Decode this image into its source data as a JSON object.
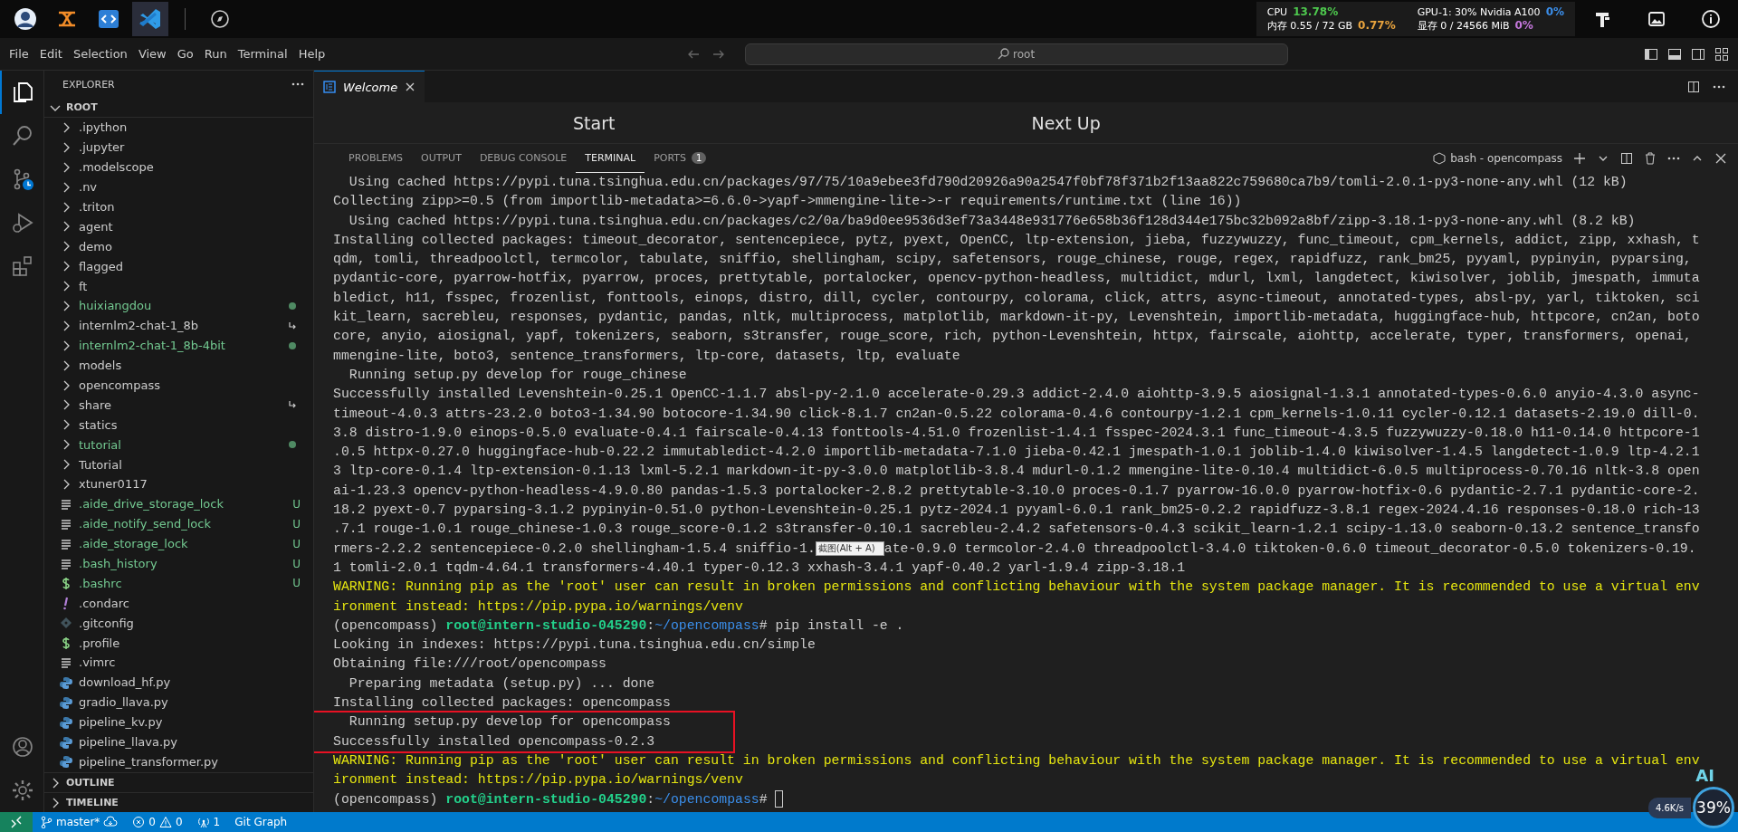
{
  "system_bar": {
    "apps": [
      {
        "selected": false
      },
      {
        "selected": false
      },
      {
        "selected": false
      },
      {
        "selected": true
      },
      {
        "selected": false
      }
    ],
    "stats": [
      {
        "label": "CPU",
        "value": "13.78%",
        "color": "#4ec94e"
      },
      {
        "label": "GPU-1: 30% Nvidia A100",
        "value": "0%",
        "color": "#3b8eea"
      },
      {
        "label": "内存 0.55 / 72 GB",
        "value": "0.77%",
        "color": "#e8a33d"
      },
      {
        "label": "显存 0 / 24566 MiB",
        "value": "0%",
        "color": "#c678dd"
      }
    ]
  },
  "title_bar": {
    "menu": [
      "File",
      "Edit",
      "Selection",
      "View",
      "Go",
      "Run",
      "Terminal",
      "Help"
    ],
    "search": "root"
  },
  "sidebar": {
    "title": "EXPLORER",
    "root": "ROOT",
    "items": [
      {
        "kind": "folder",
        "name": ".ipython",
        "color": "#cccccc"
      },
      {
        "kind": "folder",
        "name": ".jupyter",
        "color": "#cccccc"
      },
      {
        "kind": "folder",
        "name": ".modelscope",
        "color": "#cccccc"
      },
      {
        "kind": "folder",
        "name": ".nv",
        "color": "#cccccc"
      },
      {
        "kind": "folder",
        "name": ".triton",
        "color": "#cccccc"
      },
      {
        "kind": "folder",
        "name": "agent",
        "color": "#cccccc"
      },
      {
        "kind": "folder",
        "name": "demo",
        "color": "#cccccc"
      },
      {
        "kind": "folder",
        "name": "flagged",
        "color": "#cccccc"
      },
      {
        "kind": "folder",
        "name": "ft",
        "color": "#cccccc"
      },
      {
        "kind": "folder",
        "name": "huixiangdou",
        "color": "#73c991",
        "modified": true
      },
      {
        "kind": "folder",
        "name": "internlm2-chat-1_8b",
        "color": "#cccccc",
        "symlink": true
      },
      {
        "kind": "folder",
        "name": "internlm2-chat-1_8b-4bit",
        "color": "#73c991",
        "modified": true
      },
      {
        "kind": "folder",
        "name": "models",
        "color": "#cccccc"
      },
      {
        "kind": "folder",
        "name": "opencompass",
        "color": "#cccccc"
      },
      {
        "kind": "folder",
        "name": "share",
        "color": "#cccccc",
        "symlink": true
      },
      {
        "kind": "folder",
        "name": "statics",
        "color": "#cccccc"
      },
      {
        "kind": "folder",
        "name": "tutorial",
        "color": "#73c991",
        "modified": true
      },
      {
        "kind": "folder",
        "name": "Tutorial",
        "color": "#cccccc"
      },
      {
        "kind": "folder",
        "name": "xtuner0117",
        "color": "#cccccc"
      },
      {
        "kind": "text",
        "name": ".aide_drive_storage_lock",
        "color": "#73c991",
        "badge": "U"
      },
      {
        "kind": "text",
        "name": ".aide_notify_send_lock",
        "color": "#73c991",
        "badge": "U"
      },
      {
        "kind": "text",
        "name": ".aide_storage_lock",
        "color": "#73c991",
        "badge": "U"
      },
      {
        "kind": "text",
        "name": ".bash_history",
        "color": "#73c991",
        "badge": "U"
      },
      {
        "kind": "shell",
        "name": ".bashrc",
        "color": "#73c991",
        "badge": "U"
      },
      {
        "kind": "config",
        "name": ".condarc",
        "color": "#cccccc"
      },
      {
        "kind": "git",
        "name": ".gitconfig",
        "color": "#cccccc"
      },
      {
        "kind": "shell",
        "name": ".profile",
        "color": "#cccccc"
      },
      {
        "kind": "text",
        "name": ".vimrc",
        "color": "#cccccc"
      },
      {
        "kind": "python",
        "name": "download_hf.py",
        "color": "#cccccc"
      },
      {
        "kind": "python",
        "name": "gradio_llava.py",
        "color": "#cccccc"
      },
      {
        "kind": "python",
        "name": "pipeline_kv.py",
        "color": "#cccccc"
      },
      {
        "kind": "python",
        "name": "pipeline_llava.py",
        "color": "#cccccc"
      },
      {
        "kind": "python",
        "name": "pipeline_transformer.py",
        "color": "#cccccc"
      }
    ],
    "sections": [
      "OUTLINE",
      "TIMELINE"
    ]
  },
  "editor": {
    "tabs": [
      {
        "label": "Welcome",
        "selected": true
      }
    ],
    "headings": [
      "Start",
      "Next Up"
    ]
  },
  "panel": {
    "tabs": [
      {
        "label": "PROBLEMS",
        "selected": false
      },
      {
        "label": "OUTPUT",
        "selected": false
      },
      {
        "label": "DEBUG CONSOLE",
        "selected": false
      },
      {
        "label": "TERMINAL",
        "selected": true
      },
      {
        "label": "PORTS",
        "selected": false,
        "badge": "1"
      }
    ],
    "terminal_name": "bash - opencompass"
  },
  "terminal": [
    {
      "kind": "normal",
      "text": "  Using cached https://pypi.tuna.tsinghua.edu.cn/packages/97/75/10a9ebee3fd790d20926a90a2547f0bf78f371b2f13aa822c759680ca7b9/tomli-2.0.1-py3-none-any.whl (12 kB)"
    },
    {
      "kind": "normal",
      "text": "Collecting zipp>=0.5 (from importlib-metadata>=6.6.0->yapf->mmengine-lite->-r requirements/runtime.txt (line 16))"
    },
    {
      "kind": "normal",
      "text": "  Using cached https://pypi.tuna.tsinghua.edu.cn/packages/c2/0a/ba9d0ee9536d3ef73a3448e931776e658b36f128d344e175bc32b092a8bf/zipp-3.18.1-py3-none-any.whl (8.2 kB)"
    },
    {
      "kind": "normal",
      "text": "Installing collected packages: timeout_decorator, sentencepiece, pytz, pyext, OpenCC, ltp-extension, jieba, fuzzywuzzy, func_timeout, cpm_kernels, addict, zipp, xxhash, t"
    },
    {
      "kind": "normal",
      "text": "qdm, tomli, threadpoolctl, termcolor, tabulate, sniffio, shellingham, scipy, safetensors, rouge_chinese, rouge, regex, rapidfuzz, rank_bm25, pyyaml, pypinyin, pyparsing,"
    },
    {
      "kind": "normal",
      "text": "pydantic-core, pyarrow-hotfix, pyarrow, proces, prettytable, portalocker, opencv-python-headless, multidict, mdurl, lxml, langdetect, kiwisolver, joblib, jmespath, immuta"
    },
    {
      "kind": "normal",
      "text": "bledict, h11, fsspec, frozenlist, fonttools, einops, distro, dill, cycler, contourpy, colorama, click, attrs, async-timeout, annotated-types, absl-py, yarl, tiktoken, sci"
    },
    {
      "kind": "normal",
      "text": "kit_learn, sacrebleu, responses, pydantic, pandas, nltk, multiprocess, matplotlib, markdown-it-py, Levenshtein, importlib-metadata, huggingface-hub, httpcore, cn2an, boto"
    },
    {
      "kind": "normal",
      "text": "core, anyio, aiosignal, yapf, tokenizers, seaborn, s3transfer, rouge_score, rich, python-Levenshtein, httpx, fairscale, aiohttp, accelerate, typer, transformers, openai,"
    },
    {
      "kind": "normal",
      "text": "mmengine-lite, boto3, sentence_transformers, ltp-core, datasets, ltp, evaluate"
    },
    {
      "kind": "normal",
      "text": "  Running setup.py develop for rouge_chinese"
    },
    {
      "kind": "normal",
      "text": "Successfully installed Levenshtein-0.25.1 OpenCC-1.1.7 absl-py-2.1.0 accelerate-0.29.3 addict-2.4.0 aiohttp-3.9.5 aiosignal-1.3.1 annotated-types-0.6.0 anyio-4.3.0 async-"
    },
    {
      "kind": "normal",
      "text": "timeout-4.0.3 attrs-23.2.0 boto3-1.34.90 botocore-1.34.90 click-8.1.7 cn2an-0.5.22 colorama-0.4.6 contourpy-1.2.1 cpm_kernels-1.0.11 cycler-0.12.1 datasets-2.19.0 dill-0."
    },
    {
      "kind": "normal",
      "text": "3.8 distro-1.9.0 einops-0.5.0 evaluate-0.4.1 fairscale-0.4.13 fonttools-4.51.0 frozenlist-1.4.1 fsspec-2024.3.1 func_timeout-4.3.5 fuzzywuzzy-0.18.0 h11-0.14.0 httpcore-1"
    },
    {
      "kind": "normal",
      "text": ".0.5 httpx-0.27.0 huggingface-hub-0.22.2 immutabledict-4.2.0 importlib-metadata-7.1.0 jieba-0.42.1 jmespath-1.0.1 joblib-1.4.0 kiwisolver-1.4.5 langdetect-1.0.9 ltp-4.2.1"
    },
    {
      "kind": "normal",
      "text": "3 ltp-core-0.1.4 ltp-extension-0.1.13 lxml-5.2.1 markdown-it-py-3.0.0 matplotlib-3.8.4 mdurl-0.1.2 mmengine-lite-0.10.4 multidict-6.0.5 multiprocess-0.70.16 nltk-3.8 open"
    },
    {
      "kind": "normal",
      "text": "ai-1.23.3 opencv-python-headless-4.9.0.80 pandas-1.5.3 portalocker-2.8.2 prettytable-3.10.0 proces-0.1.7 pyarrow-16.0.0 pyarrow-hotfix-0.6 pydantic-2.7.1 pydantic-core-2."
    },
    {
      "kind": "normal",
      "text": "18.2 pyext-0.7 pyparsing-3.1.2 pypinyin-0.51.0 python-Levenshtein-0.25.1 pytz-2024.1 pyyaml-6.0.1 rank_bm25-0.2.2 rapidfuzz-3.8.1 regex-2024.4.16 responses-0.18.0 rich-13"
    },
    {
      "kind": "normal",
      "text": ".7.1 rouge-1.0.1 rouge_chinese-1.0.3 rouge_score-0.1.2 s3transfer-0.10.1 sacrebleu-2.4.2 safetensors-0.4.3 scikit_learn-1.2.1 scipy-1.13.0 seaborn-0.13.2 sentence_transfo"
    },
    {
      "kind": "covered",
      "text": "rmers-2.2.2 sentencepiece-0.2.0 shellingham-1.5.4 sniffio-1.",
      "tooltip": "截图(Alt + A)",
      "after": "ate-0.9.0 termcolor-2.4.0 threadpoolctl-3.4.0 tiktoken-0.6.0 timeout_decorator-0.5.0 tokenizers-0.19."
    },
    {
      "kind": "normal",
      "text": "1 tomli-2.0.1 tqdm-4.64.1 transformers-4.40.1 typer-0.12.3 xxhash-3.4.1 yapf-0.40.2 yarl-1.9.4 zipp-3.18.1"
    },
    {
      "kind": "warning",
      "text": "WARNING: Running pip as the 'root' user can result in broken permissions and conflicting behaviour with the system package manager. It is recommended to use a virtual env"
    },
    {
      "kind": "warning",
      "text": "ironment instead: https://pip.pypa.io/warnings/venv"
    },
    {
      "kind": "prompt",
      "env": "(opencompass)",
      "user": "root@intern-studio-045290",
      "sep": ":",
      "path": "~/opencompass",
      "mark": "#",
      "command": " pip install -e ."
    },
    {
      "kind": "normal",
      "text": "Looking in indexes: https://pypi.tuna.tsinghua.edu.cn/simple"
    },
    {
      "kind": "normal",
      "text": "Obtaining file:///root/opencompass"
    },
    {
      "kind": "normal",
      "text": "  Preparing metadata (setup.py) ... done"
    },
    {
      "kind": "normal",
      "text": "Installing collected packages: opencompass"
    },
    {
      "kind": "normal",
      "text": "  Running setup.py develop for opencompass",
      "highlighted": true
    },
    {
      "kind": "normal",
      "text": "Successfully installed opencompass-0.2.3",
      "highlighted": true
    },
    {
      "kind": "warning",
      "text": "WARNING: Running pip as the 'root' user can result in broken permissions and conflicting behaviour with the system package manager. It is recommended to use a virtual env"
    },
    {
      "kind": "warning",
      "text": "ironment instead: https://pip.pypa.io/warnings/venv"
    },
    {
      "kind": "prompt",
      "env": "(opencompass)",
      "user": "root@intern-studio-045290",
      "sep": ":",
      "path": "~/opencompass",
      "mark": "#",
      "cursor": true
    }
  ],
  "status_bar": {
    "branch": "master*",
    "errors": "0",
    "warnings": "0",
    "ports": "1",
    "git_graph": "Git Graph"
  },
  "net_widget": {
    "label": "AI",
    "speed": "4.6K/s",
    "percent": "39%"
  }
}
